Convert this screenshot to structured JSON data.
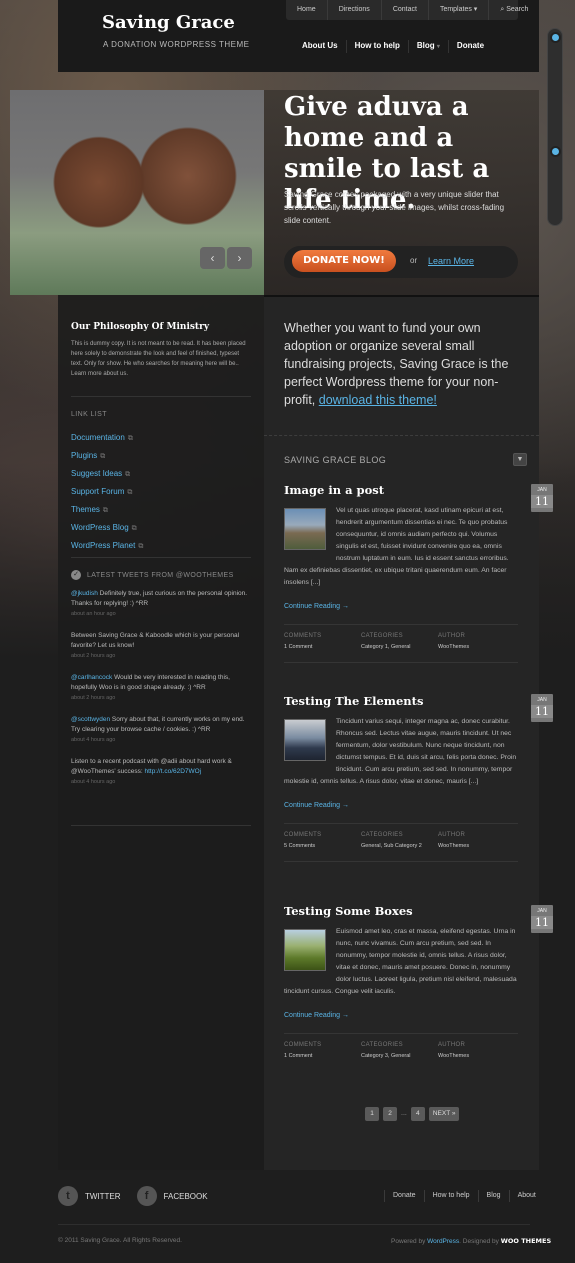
{
  "site": {
    "title": "Saving Grace",
    "tagline": "A DONATION WORDPRESS THEME"
  },
  "topnav": [
    {
      "label": "Home"
    },
    {
      "label": "Directions"
    },
    {
      "label": "Contact"
    },
    {
      "label": "Templates"
    },
    {
      "label": "Search"
    }
  ],
  "mainnav": [
    {
      "label": "About Us"
    },
    {
      "label": "How to help"
    },
    {
      "label": "Blog"
    },
    {
      "label": "Donate"
    }
  ],
  "hero": {
    "title": "Give aduva a home and a smile to last a life time.",
    "text": "Saving Grace comes packaged with a very unique slider that scrolls vertically through your slide images, whilst cross-fading slide content.",
    "donate_label": "DONATE NOW!",
    "or_label": "or",
    "learn_label": "Learn More",
    "prev_icon": "‹",
    "next_icon": "›"
  },
  "philosophy": {
    "title": "Our Philosophy Of Ministry",
    "text": "This is dummy copy. It is not meant to be read. It has been placed here solely to demonstrate the look and feel of finished, typeset text. Only for show. He who searches for meaning here will be.. Learn more about us."
  },
  "link_list": {
    "title": "LINK LIST",
    "items": [
      {
        "label": "Documentation"
      },
      {
        "label": "Plugins"
      },
      {
        "label": "Suggest Ideas"
      },
      {
        "label": "Support Forum"
      },
      {
        "label": "Themes"
      },
      {
        "label": "WordPress Blog"
      },
      {
        "label": "WordPress Planet"
      }
    ]
  },
  "tweets": {
    "title": "LATEST TWEETS FROM @WOOTHEMES",
    "items": [
      {
        "user": "@jkudish",
        "text": " Definitely true, just curious on the personal opinion. Thanks for replying! :) ^RR",
        "link": "",
        "time": "about an hour ago"
      },
      {
        "user": "",
        "text": "Between Saving Grace & Kaboodle which is your personal favorite? Let us know!",
        "link": "",
        "time": "about 2 hours ago"
      },
      {
        "user": "@carlhancock",
        "text": " Would be very interested in reading this, hopefully Woo is in good shape already. :) ^RR",
        "link": "",
        "time": "about 2 hours ago"
      },
      {
        "user": "@scottwyden",
        "text": " Sorry about that, it currently works on my end. Try clearing your browse cache / cookies. :) ^RR",
        "link": "",
        "time": "about 4 hours ago"
      },
      {
        "user": "",
        "text": "Listen to a recent podcast with @adii about hard work & @WooThemes' success: ",
        "link": "http://t.co/62D7WOj",
        "time": "about 4 hours ago"
      }
    ]
  },
  "intro": {
    "text": "Whether you want to fund your own adoption or organize several small fundraising projects, Saving Grace is the perfect Wordpress theme for your non-profit, ",
    "link": "download this theme!"
  },
  "blog": {
    "heading": "SAVING GRACE BLOG",
    "toggle_icon": "▼",
    "continue_label": "Continue Reading →",
    "meta_labels": {
      "comments": "COMMENTS",
      "categories": "CATEGORIES",
      "author": "AUTHOR"
    },
    "posts": [
      {
        "title": "Image in a post",
        "body": "Vel ut quas utroque placerat, kasd utinam epicuri at est, hendrerit argumentum dissentias ei nec. Te quo probatus consequuntur, id omnis audiam perfecto qui. Volumus singulis et est, fuisset invidunt convenire quo ea, omnis nostrum luptatum in eum. Ius id essent sanctus erroribus. Nam ex definiebas dissentiet, ex ubique tritani quaerendum eum. An facer insolens [...]",
        "comments": "1 Comment",
        "categories": "Category 1, General",
        "author": "WooThemes",
        "date_mon": "JAN",
        "date_day": "11"
      },
      {
        "title": "Testing The Elements",
        "body": "Tincidunt varius sequi, integer magna ac, donec curabitur. Rhoncus sed. Lectus vitae augue, mauris tincidunt. Ut nec fermentum, dolor vestibulum. Nunc neque tincidunt, non dictumst tempus. Et id, duis sit arcu, felis porta donec. Proin tincidunt. Cum arcu pretium, sed sed. In nonummy, tempor molestie id, omnis tellus. A risus dolor, vitae et donec, mauris [...]",
        "comments": "5 Comments",
        "categories": "General, Sub Category 2",
        "author": "WooThemes",
        "date_mon": "JAN",
        "date_day": "11"
      },
      {
        "title": "Testing Some Boxes",
        "body": "Euismod amet leo, cras et massa, eleifend egestas. Urna in nunc, nunc vivamus. Cum arcu pretium, sed sed. In nonummy, tempor molestie id, omnis tellus. A risus dolor, vitae et donec, mauris amet posuere. Donec in, nonummy dolor luctus. Laoreet ligula, pretium nisl eleifend, malesuada tincidunt cursus. Congue velit iaculis.",
        "comments": "1 Comment",
        "categories": "Category 3, General",
        "author": "WooThemes",
        "date_mon": "JAN",
        "date_day": "11"
      }
    ]
  },
  "pagination": {
    "p1": "1",
    "p2": "2",
    "dots": "...",
    "p4": "4",
    "next": "NEXT »"
  },
  "footer": {
    "twitter_label": "TWITTER",
    "twitter_icon": "t",
    "facebook_label": "FACEBOOK",
    "facebook_icon": "f",
    "nav": [
      {
        "label": "Donate"
      },
      {
        "label": "How to help"
      },
      {
        "label": "Blog"
      },
      {
        "label": "About"
      }
    ],
    "copyright": "© 2011 Saving Grace. All Rights Reserved.",
    "powered_prefix": "Powered by ",
    "powered_link": "WordPress",
    "designed_by": ". Designed by ",
    "designer": "WOO THEMES"
  }
}
